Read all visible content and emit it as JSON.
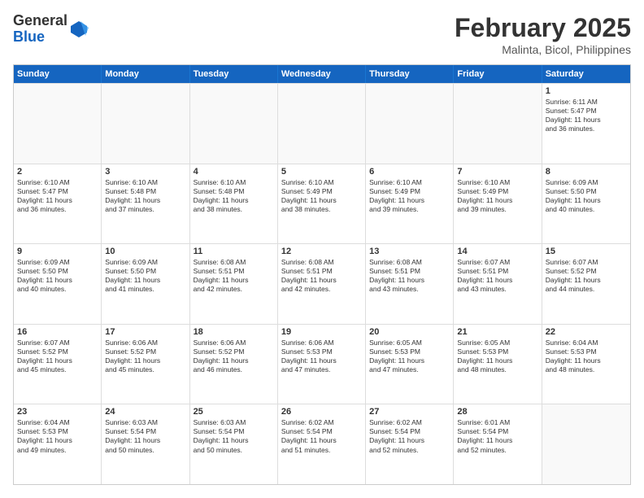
{
  "logo": {
    "general": "General",
    "blue": "Blue"
  },
  "header": {
    "month": "February 2025",
    "location": "Malinta, Bicol, Philippines"
  },
  "days": [
    "Sunday",
    "Monday",
    "Tuesday",
    "Wednesday",
    "Thursday",
    "Friday",
    "Saturday"
  ],
  "weeks": [
    [
      {
        "day": "",
        "info": ""
      },
      {
        "day": "",
        "info": ""
      },
      {
        "day": "",
        "info": ""
      },
      {
        "day": "",
        "info": ""
      },
      {
        "day": "",
        "info": ""
      },
      {
        "day": "",
        "info": ""
      },
      {
        "day": "1",
        "info": "Sunrise: 6:11 AM\nSunset: 5:47 PM\nDaylight: 11 hours\nand 36 minutes."
      }
    ],
    [
      {
        "day": "2",
        "info": "Sunrise: 6:10 AM\nSunset: 5:47 PM\nDaylight: 11 hours\nand 36 minutes."
      },
      {
        "day": "3",
        "info": "Sunrise: 6:10 AM\nSunset: 5:48 PM\nDaylight: 11 hours\nand 37 minutes."
      },
      {
        "day": "4",
        "info": "Sunrise: 6:10 AM\nSunset: 5:48 PM\nDaylight: 11 hours\nand 38 minutes."
      },
      {
        "day": "5",
        "info": "Sunrise: 6:10 AM\nSunset: 5:49 PM\nDaylight: 11 hours\nand 38 minutes."
      },
      {
        "day": "6",
        "info": "Sunrise: 6:10 AM\nSunset: 5:49 PM\nDaylight: 11 hours\nand 39 minutes."
      },
      {
        "day": "7",
        "info": "Sunrise: 6:10 AM\nSunset: 5:49 PM\nDaylight: 11 hours\nand 39 minutes."
      },
      {
        "day": "8",
        "info": "Sunrise: 6:09 AM\nSunset: 5:50 PM\nDaylight: 11 hours\nand 40 minutes."
      }
    ],
    [
      {
        "day": "9",
        "info": "Sunrise: 6:09 AM\nSunset: 5:50 PM\nDaylight: 11 hours\nand 40 minutes."
      },
      {
        "day": "10",
        "info": "Sunrise: 6:09 AM\nSunset: 5:50 PM\nDaylight: 11 hours\nand 41 minutes."
      },
      {
        "day": "11",
        "info": "Sunrise: 6:08 AM\nSunset: 5:51 PM\nDaylight: 11 hours\nand 42 minutes."
      },
      {
        "day": "12",
        "info": "Sunrise: 6:08 AM\nSunset: 5:51 PM\nDaylight: 11 hours\nand 42 minutes."
      },
      {
        "day": "13",
        "info": "Sunrise: 6:08 AM\nSunset: 5:51 PM\nDaylight: 11 hours\nand 43 minutes."
      },
      {
        "day": "14",
        "info": "Sunrise: 6:07 AM\nSunset: 5:51 PM\nDaylight: 11 hours\nand 43 minutes."
      },
      {
        "day": "15",
        "info": "Sunrise: 6:07 AM\nSunset: 5:52 PM\nDaylight: 11 hours\nand 44 minutes."
      }
    ],
    [
      {
        "day": "16",
        "info": "Sunrise: 6:07 AM\nSunset: 5:52 PM\nDaylight: 11 hours\nand 45 minutes."
      },
      {
        "day": "17",
        "info": "Sunrise: 6:06 AM\nSunset: 5:52 PM\nDaylight: 11 hours\nand 45 minutes."
      },
      {
        "day": "18",
        "info": "Sunrise: 6:06 AM\nSunset: 5:52 PM\nDaylight: 11 hours\nand 46 minutes."
      },
      {
        "day": "19",
        "info": "Sunrise: 6:06 AM\nSunset: 5:53 PM\nDaylight: 11 hours\nand 47 minutes."
      },
      {
        "day": "20",
        "info": "Sunrise: 6:05 AM\nSunset: 5:53 PM\nDaylight: 11 hours\nand 47 minutes."
      },
      {
        "day": "21",
        "info": "Sunrise: 6:05 AM\nSunset: 5:53 PM\nDaylight: 11 hours\nand 48 minutes."
      },
      {
        "day": "22",
        "info": "Sunrise: 6:04 AM\nSunset: 5:53 PM\nDaylight: 11 hours\nand 48 minutes."
      }
    ],
    [
      {
        "day": "23",
        "info": "Sunrise: 6:04 AM\nSunset: 5:53 PM\nDaylight: 11 hours\nand 49 minutes."
      },
      {
        "day": "24",
        "info": "Sunrise: 6:03 AM\nSunset: 5:54 PM\nDaylight: 11 hours\nand 50 minutes."
      },
      {
        "day": "25",
        "info": "Sunrise: 6:03 AM\nSunset: 5:54 PM\nDaylight: 11 hours\nand 50 minutes."
      },
      {
        "day": "26",
        "info": "Sunrise: 6:02 AM\nSunset: 5:54 PM\nDaylight: 11 hours\nand 51 minutes."
      },
      {
        "day": "27",
        "info": "Sunrise: 6:02 AM\nSunset: 5:54 PM\nDaylight: 11 hours\nand 52 minutes."
      },
      {
        "day": "28",
        "info": "Sunrise: 6:01 AM\nSunset: 5:54 PM\nDaylight: 11 hours\nand 52 minutes."
      },
      {
        "day": "",
        "info": ""
      }
    ]
  ]
}
